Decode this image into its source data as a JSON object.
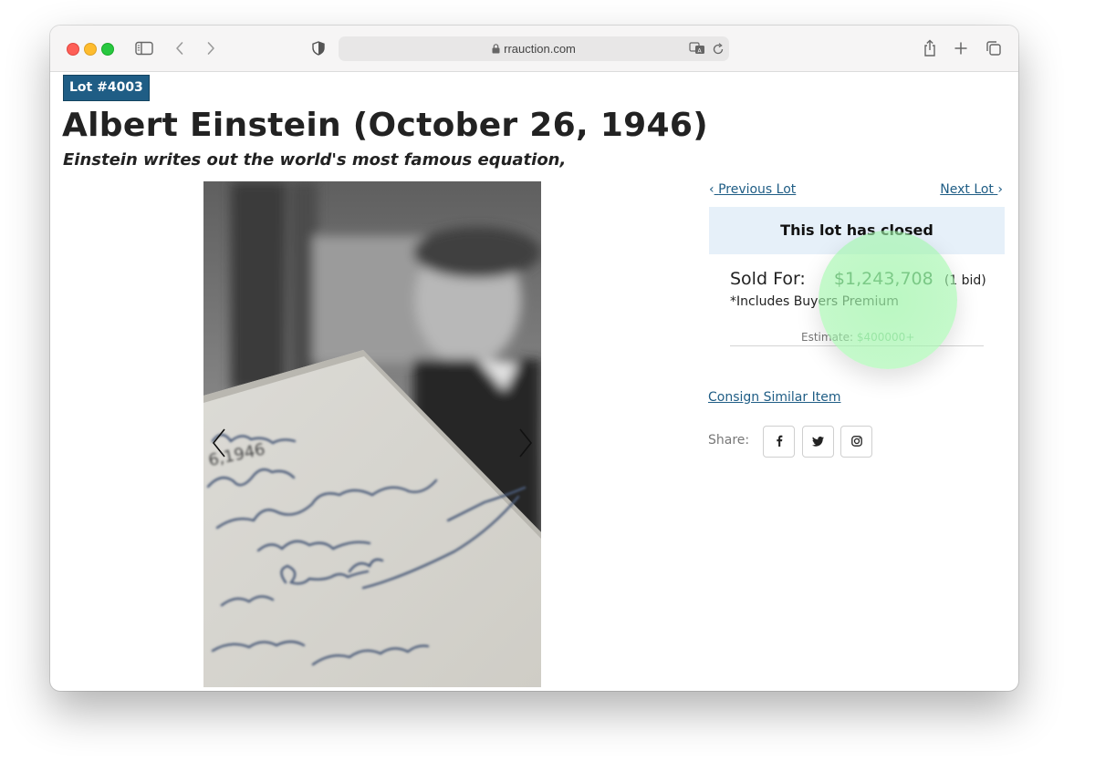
{
  "browser": {
    "url": "rrauction.com"
  },
  "lot": {
    "badge": "Lot #4003",
    "title": "Albert Einstein (October 26, 1946)",
    "subtitle": "Einstein writes out the world's most famous equation,"
  },
  "photo": {
    "alt": "Einstein handwritten manuscript with equation"
  },
  "navigation": {
    "prev_label": "Previous Lot",
    "next_label": "Next Lot"
  },
  "status": {
    "closed_text": "This lot has closed"
  },
  "sale": {
    "sold_label": "Sold For:",
    "price": "$1,243,708",
    "bids": "(1 bid)",
    "premium_note": "*Includes Buyers Premium",
    "estimate_label": "Estimate:",
    "estimate_value": "$400000+"
  },
  "actions": {
    "consign_label": "Consign Similar Item",
    "share_label": "Share:"
  },
  "icons": {
    "share": [
      "facebook-icon",
      "twitter-icon",
      "instagram-icon"
    ]
  },
  "colors": {
    "badge_bg": "#1f5d85",
    "link": "#1f5d85",
    "closed_bg": "#e6f0f9",
    "price": "#2e6e3c",
    "highlight": "#a0f5aa"
  }
}
